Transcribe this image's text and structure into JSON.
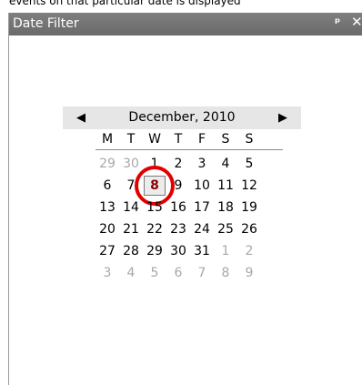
{
  "top_caption": "events on that particular date is displayed",
  "window": {
    "title": "Date Filter"
  },
  "icons": {
    "pin": "pin-icon",
    "close": "close-icon",
    "prev": "chevron-left-icon",
    "next": "chevron-right-icon"
  },
  "colors": {
    "titlebar": "#6f6f6f",
    "selected_text": "#8b0000",
    "highlight_circle": "#e00000",
    "other_month": "#a8a8a8"
  },
  "glyphs": {
    "pin": "ᵖ",
    "close": "✕",
    "prev": "◀",
    "next": "▶"
  },
  "calendar": {
    "month_label": "December, 2010",
    "weekdays": [
      "M",
      "T",
      "W",
      "T",
      "F",
      "S",
      "S"
    ],
    "selected_day": "8",
    "weeks": [
      [
        {
          "d": "29",
          "other": true
        },
        {
          "d": "30",
          "other": true
        },
        {
          "d": "1"
        },
        {
          "d": "2"
        },
        {
          "d": "3"
        },
        {
          "d": "4"
        },
        {
          "d": "5"
        }
      ],
      [
        {
          "d": "6"
        },
        {
          "d": "7"
        },
        {
          "d": "8",
          "selected": true
        },
        {
          "d": "9"
        },
        {
          "d": "10"
        },
        {
          "d": "11"
        },
        {
          "d": "12"
        }
      ],
      [
        {
          "d": "13"
        },
        {
          "d": "14"
        },
        {
          "d": "15"
        },
        {
          "d": "16"
        },
        {
          "d": "17"
        },
        {
          "d": "18"
        },
        {
          "d": "19"
        }
      ],
      [
        {
          "d": "20"
        },
        {
          "d": "21"
        },
        {
          "d": "22"
        },
        {
          "d": "23"
        },
        {
          "d": "24"
        },
        {
          "d": "25"
        },
        {
          "d": "26"
        }
      ],
      [
        {
          "d": "27"
        },
        {
          "d": "28"
        },
        {
          "d": "29"
        },
        {
          "d": "30"
        },
        {
          "d": "31"
        },
        {
          "d": "1",
          "other": true
        },
        {
          "d": "2",
          "other": true
        }
      ],
      [
        {
          "d": "3",
          "other": true
        },
        {
          "d": "4",
          "other": true
        },
        {
          "d": "5",
          "other": true
        },
        {
          "d": "6",
          "other": true
        },
        {
          "d": "7",
          "other": true
        },
        {
          "d": "8",
          "other": true
        },
        {
          "d": "9",
          "other": true
        }
      ]
    ]
  }
}
